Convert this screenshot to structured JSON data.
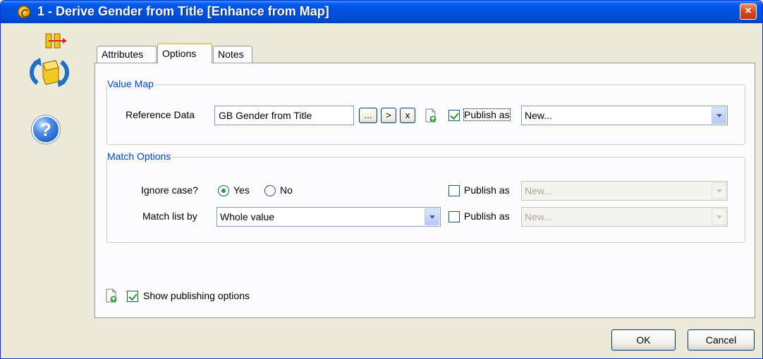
{
  "window": {
    "title": "1 - Derive Gender from Title [Enhance from Map]",
    "close_label": "×"
  },
  "tabs": [
    {
      "label": "Attributes"
    },
    {
      "label": "Options"
    },
    {
      "label": "Notes"
    }
  ],
  "value_map": {
    "group_label": "Value Map",
    "reference_data_label": "Reference Data",
    "reference_data_value": "GB Gender from Title",
    "browse_label": "...",
    "open_label": ">",
    "clear_label": "x",
    "publish_checked": true,
    "publish_label": "Publish as",
    "publish_value": "New..."
  },
  "match_options": {
    "group_label": "Match Options",
    "ignore_case_label": "Ignore case?",
    "yes_label": "Yes",
    "no_label": "No",
    "ignore_case_value": "Yes",
    "publish1_checked": false,
    "publish1_label": "Publish as",
    "publish1_value": "New...",
    "match_list_label": "Match list by",
    "match_list_value": "Whole value",
    "publish2_checked": false,
    "publish2_label": "Publish as",
    "publish2_value": "New..."
  },
  "show_publishing": {
    "checked": true,
    "label": "Show publishing options"
  },
  "footer": {
    "ok_label": "OK",
    "cancel_label": "Cancel"
  },
  "icons": {
    "title": "processor-gear-icon",
    "process": "enhance-from-map-icon",
    "help": "help-icon",
    "publish": "publish-data-icon"
  }
}
